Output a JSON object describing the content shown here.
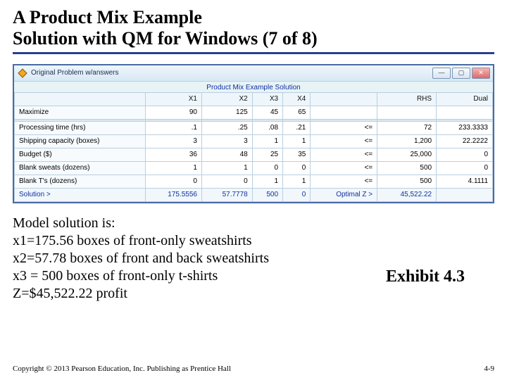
{
  "title_line1": "A Product Mix Example",
  "title_line2": "Solution with QM for Windows (7 of 8)",
  "qm": {
    "win_title": "Original Problem w/answers",
    "subtitle": "Product Mix Example Solution",
    "headers": [
      "",
      "X1",
      "X2",
      "X3",
      "X4",
      "",
      "RHS",
      "Dual"
    ],
    "rows": [
      {
        "label": "Maximize",
        "x1": "90",
        "x2": "125",
        "x3": "45",
        "x4": "65",
        "rel": "",
        "rhs": "",
        "dual": ""
      },
      {
        "label": "Processing time (hrs)",
        "x1": ".1",
        "x2": ".25",
        "x3": ".08",
        "x4": ".21",
        "rel": "<=",
        "rhs": "72",
        "dual": "233.3333"
      },
      {
        "label": "Shipping capacity (boxes)",
        "x1": "3",
        "x2": "3",
        "x3": "1",
        "x4": "1",
        "rel": "<=",
        "rhs": "1,200",
        "dual": "22.2222"
      },
      {
        "label": "Budget ($)",
        "x1": "36",
        "x2": "48",
        "x3": "25",
        "x4": "35",
        "rel": "<=",
        "rhs": "25,000",
        "dual": "0"
      },
      {
        "label": "Blank sweats (dozens)",
        "x1": "1",
        "x2": "1",
        "x3": "0",
        "x4": "0",
        "rel": "<=",
        "rhs": "500",
        "dual": "0"
      },
      {
        "label": "Blank T's (dozens)",
        "x1": "0",
        "x2": "0",
        "x3": "1",
        "x4": "1",
        "rel": "<=",
        "rhs": "500",
        "dual": "4.1111"
      }
    ],
    "solution": {
      "label": "Solution >",
      "x1": "175.5556",
      "x2": "57.7778",
      "x3": "500",
      "x4": "0",
      "opt_label": "Optimal Z >",
      "opt": "45,522.22"
    }
  },
  "body": {
    "l1": "Model solution is:",
    "l2": "x1=175.56 boxes of front-only sweatshirts",
    "l3": "x2=57.78 boxes of front and back sweatshirts",
    "l4": "x3 = 500 boxes of front-only t-shirts",
    "l5": "Z=$45,522.22 profit"
  },
  "exhibit": "Exhibit 4.3",
  "footer_left": "Copyright © 2013 Pearson Education, Inc. Publishing as Prentice Hall",
  "footer_right": "4-9"
}
